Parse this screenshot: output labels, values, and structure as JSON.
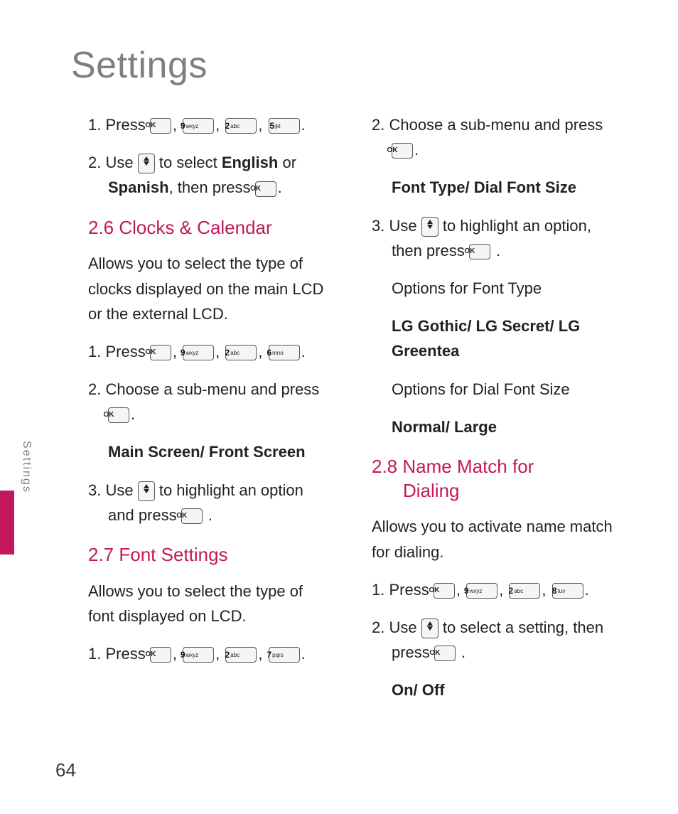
{
  "pageTitle": "Settings",
  "sideLabel": "Settings",
  "pageNumber": "64",
  "keys": {
    "ok": "OK",
    "k9": {
      "d": "9",
      "l": "wxyz"
    },
    "k2": {
      "d": "2",
      "l": "abc"
    },
    "k5": {
      "d": "5",
      "l": "jkl"
    },
    "k6": {
      "d": "6",
      "l": "mno"
    },
    "k7": {
      "d": "7",
      "l": "pqrs"
    },
    "k8": {
      "d": "8",
      "l": "tuv"
    }
  },
  "left": {
    "s1_prefix": "1. Press ",
    "s2_prefix": "2. Use ",
    "s2_mid": " to select ",
    "s2_english": "English",
    "s2_or": " or ",
    "s2_spanish": "Spanish",
    "s2_then": ", then press ",
    "h26": "2.6 Clocks & Calendar",
    "p26": "Allows you to select the type of clocks displayed on the main LCD or the external LCD.",
    "s26_1": "1. Press ",
    "s26_2": "2. Choose a sub-menu and press ",
    "sub26": "Main Screen/ Front Screen",
    "s26_3a": "3. Use ",
    "s26_3b": " to highlight an option and press ",
    "h27": "2.7 Font Settings",
    "p27": "Allows you to select the type of font displayed on LCD.",
    "s27_1": "1. Press "
  },
  "right": {
    "s27_2": "2. Choose a sub-menu and press ",
    "sub27": "Font Type/ Dial Font Size",
    "s27_3a": "3. Use ",
    "s27_3b": " to highlight an option, then press ",
    "opt_ft_label": "Options for Font Type",
    "opt_ft_values": "LG Gothic/ LG Secret/ LG Greentea",
    "opt_dfs_label": "Options for Dial Font Size",
    "opt_dfs_values": "Normal/ Large",
    "h28a": "2.8 Name Match for",
    "h28b": "Dialing",
    "p28": "Allows you to activate name match for dialing.",
    "s28_1": "1. Press ",
    "s28_2a": "2. Use ",
    "s28_2b": " to select a setting, then press ",
    "s28_vals": "On/ Off"
  }
}
